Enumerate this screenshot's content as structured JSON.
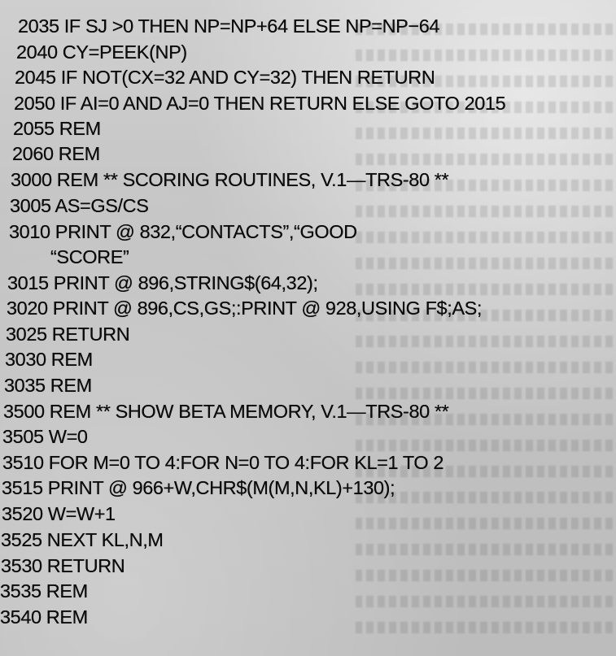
{
  "listing": {
    "lines": [
      "2035 IF SJ >0 THEN NP=NP+64 ELSE NP=NP−64",
      "2040 CY=PEEK(NP)",
      "2045 IF NOT(CX=32 AND CY=32) THEN RETURN",
      "2050 IF AI=0 AND AJ=0 THEN RETURN ELSE GOTO 2015",
      "2055 REM",
      "2060 REM",
      "3000 REM ** SCORING ROUTINES, V.1—TRS-80 **",
      "3005 AS=GS/CS",
      "3010 PRINT @ 832,“CONTACTS”,“GOOD",
      "“SCORE”",
      "3015 PRINT @ 896,STRING$(64,32);",
      "3020 PRINT @ 896,CS,GS;:PRINT @ 928,USING F$;AS;",
      "3025 RETURN",
      "3030 REM",
      "3035 REM",
      "3500 REM ** SHOW BETA MEMORY, V.1—TRS-80 **",
      "3505 W=0",
      "3510 FOR M=0 TO 4:FOR N=0 TO 4:FOR KL=1 TO 2",
      "3515 PRINT @ 966+W,CHR$(M(M,N,KL)+130);",
      "3520 W=W+1",
      "3525 NEXT KL,N,M",
      "3530 RETURN",
      "3535 REM",
      "3540 REM"
    ]
  }
}
